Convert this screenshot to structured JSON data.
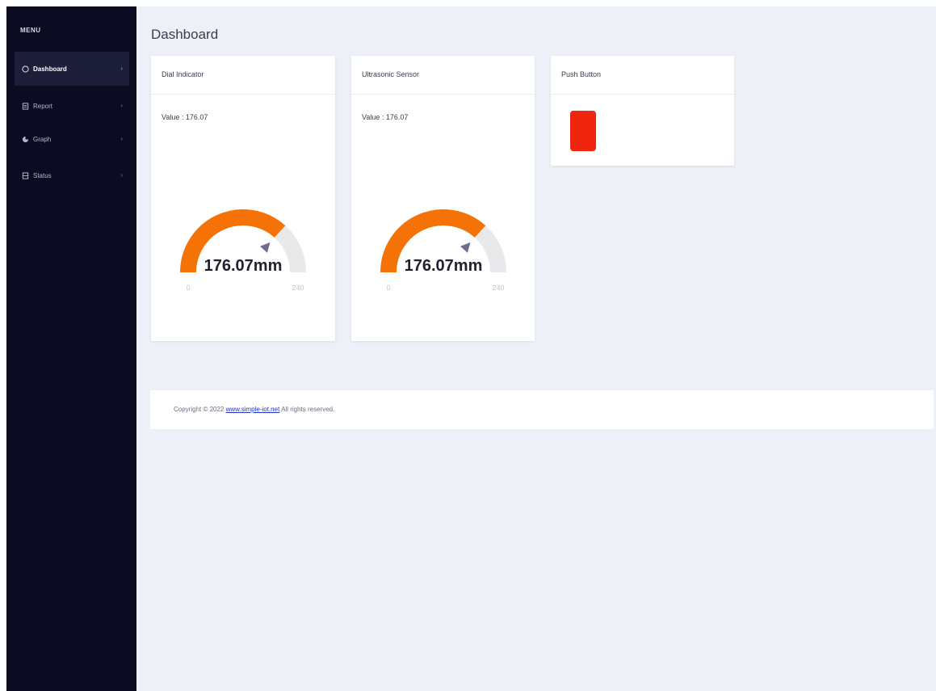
{
  "sidebar": {
    "menu_title": "MENU",
    "items": [
      {
        "label": "Dashboard",
        "active": true,
        "icon": "dashboard-icon"
      },
      {
        "label": "Report",
        "active": false,
        "icon": "report-icon"
      },
      {
        "label": "Graph",
        "active": false,
        "icon": "graph-icon"
      },
      {
        "label": "Status",
        "active": false,
        "icon": "status-icon"
      }
    ]
  },
  "page": {
    "title": "Dashboard"
  },
  "cards": {
    "dial": {
      "title": "Dial Indicator",
      "value_text": "Value : 176.07",
      "gauge_label": "176.07mm",
      "value": 176.07,
      "min_label": "0",
      "max_label": "240",
      "min": 0,
      "max": 240
    },
    "ultrasonic": {
      "title": "Ultrasonic Sensor",
      "value_text": "Value : 176.07",
      "gauge_label": "176.07mm",
      "value": 176.07,
      "min_label": "0",
      "max_label": "240",
      "min": 0,
      "max": 240
    },
    "push": {
      "title": "Push Button"
    }
  },
  "footer": {
    "prefix": "Copyright © 2022",
    "link": "www.simple-iot.net",
    "suffix": " All rights reserved."
  },
  "colors": {
    "sidebar_bg": "#0b0c22",
    "gauge_fill": "#f57206",
    "gauge_track": "#e9e9ec",
    "push_button": "#f0250f",
    "pointer": "#6b6e8c"
  }
}
